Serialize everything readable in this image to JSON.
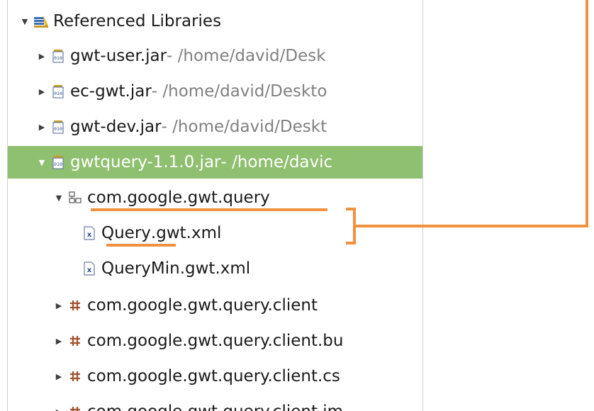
{
  "tree": {
    "referenced_libraries": {
      "label": "Referenced Libraries",
      "icon": "library-icon"
    },
    "jars": [
      {
        "name": "gwt-user.jar",
        "path": " - /home/david/Desk",
        "icon": "jar-icon"
      },
      {
        "name": "ec-gwt.jar",
        "path": " - /home/david/Deskto",
        "icon": "jar-icon"
      },
      {
        "name": "gwt-dev.jar",
        "path": " - /home/david/Deskt",
        "icon": "jar-icon"
      },
      {
        "name": "gwtquery-1.1.0.jar",
        "path": " - /home/davic",
        "icon": "jar-icon",
        "selected": true
      }
    ],
    "folder": {
      "label": "com.google.gwt.query",
      "icon": "package-folder-icon"
    },
    "files": [
      {
        "label_prefix": "Query",
        "label_suffix": ".gwt.xml",
        "icon": "xml-file-icon"
      },
      {
        "label": "QueryMin.gwt.xml",
        "icon": "xml-file-icon"
      }
    ],
    "packages": [
      {
        "label": "com.google.gwt.query.client",
        "icon": "package-icon"
      },
      {
        "label": "com.google.gwt.query.client.bu",
        "icon": "package-icon"
      },
      {
        "label": "com.google.gwt.query.client.cs",
        "icon": "package-icon"
      },
      {
        "label": "com.google.gwt.query.client.im",
        "icon": "package-icon"
      }
    ]
  },
  "colors": {
    "selection": "#8fc06f",
    "callout": "#f0913d",
    "path_text": "#808080",
    "package_icon": "#a0522d"
  }
}
